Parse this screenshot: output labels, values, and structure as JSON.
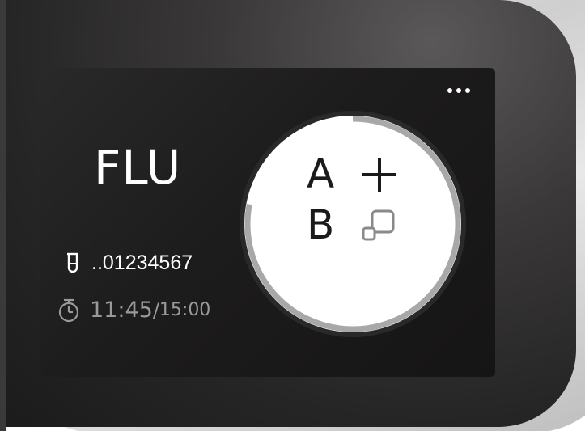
{
  "screen": {
    "more_menu": {
      "icon": "more-horizontal-icon"
    },
    "test_name": "FLU",
    "sample": {
      "icon": "test-tube-icon",
      "id": "..01234567"
    },
    "timer": {
      "icon": "stopwatch-icon",
      "elapsed": "11:45",
      "separator": "/",
      "total": "15:00"
    },
    "results": {
      "a": {
        "label": "A",
        "status": "positive",
        "icon": "plus-icon"
      },
      "b": {
        "label": "B",
        "status": "pending",
        "icon": "overlapping-squares-icon"
      },
      "progress_fraction": 0.78
    }
  },
  "colors": {
    "screen_background": "#1d1c1c",
    "text_primary": "#ffffff",
    "text_secondary": "#9a9a9a",
    "dial_face": "#ffffff",
    "dial_ring": "#a8a8a8"
  }
}
